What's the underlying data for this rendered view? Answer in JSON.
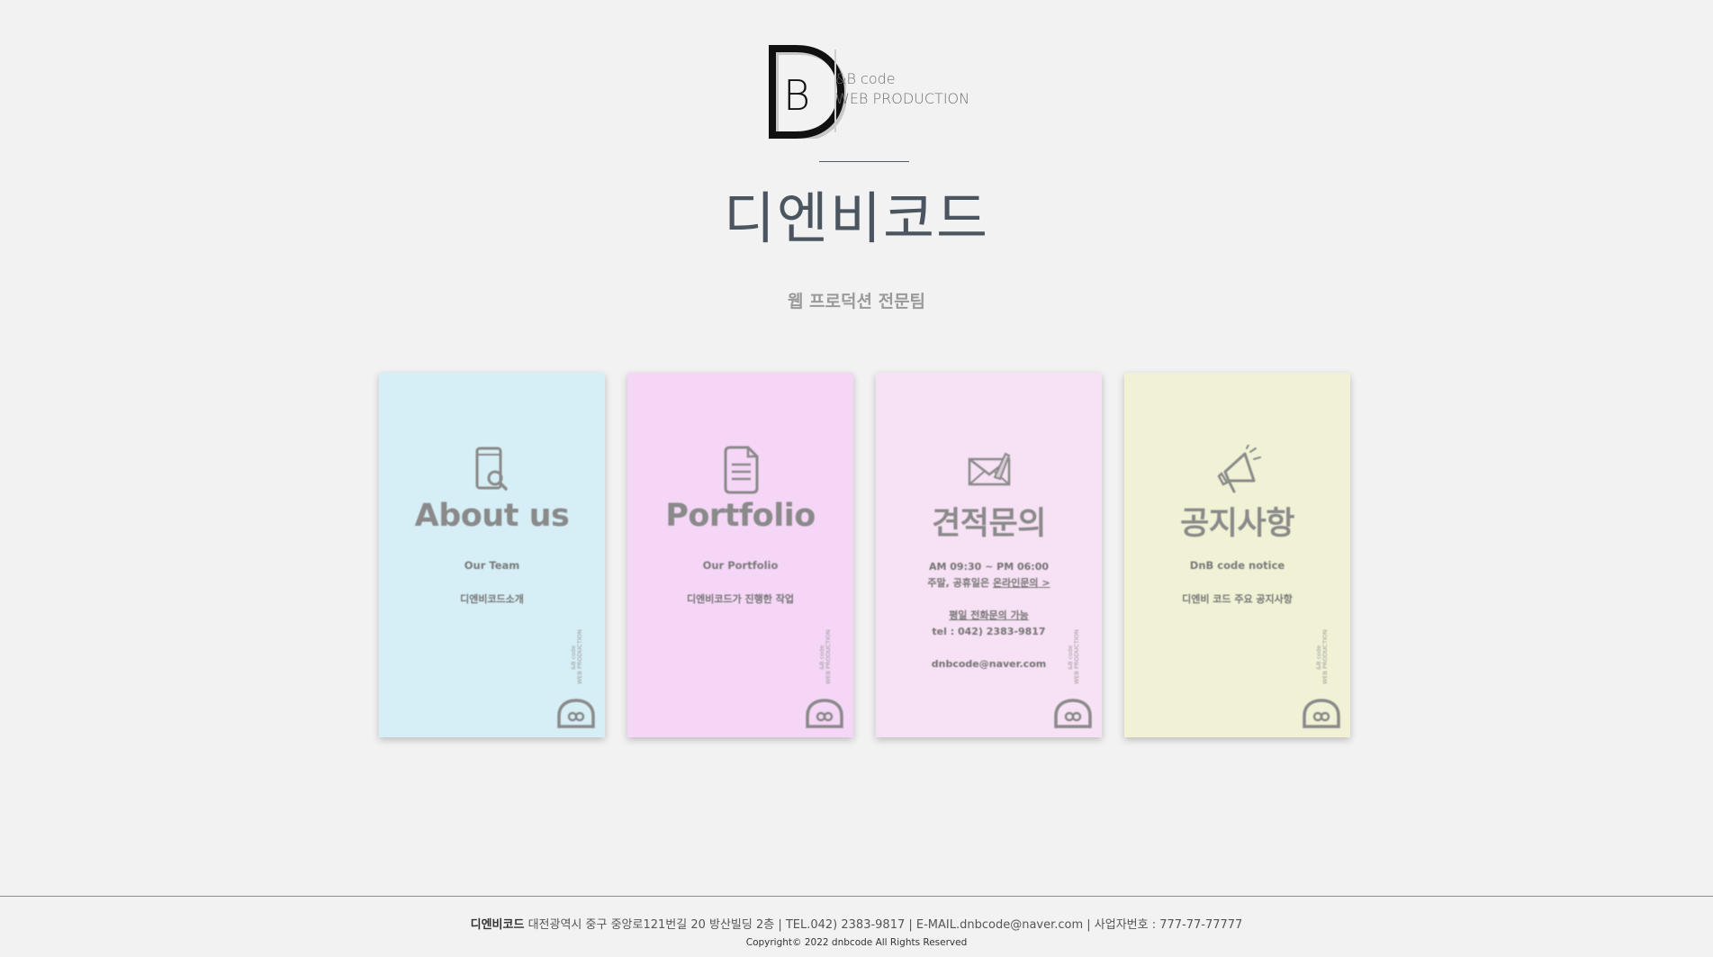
{
  "logo": {
    "letter_outer": "D",
    "letter_inner": "B",
    "line1": "&B code",
    "line2": "WEB PRODUCTION"
  },
  "header": {
    "title": "디엔비코드",
    "subtitle": "웹 프로덕션 전문팀"
  },
  "cards": [
    {
      "title": "About us",
      "sub": "Our Team",
      "desc": "디엔비코드소개",
      "bg": "#d6eff6",
      "icon": "phone-search-icon"
    },
    {
      "title": "Portfolio",
      "sub": "Our Portfolio",
      "desc": "디엔비코드가 진행한 작업",
      "bg": "#f5d6f6",
      "icon": "document-icon"
    },
    {
      "title": "견적문의",
      "hours": "AM 09:30 ~ PM 06:00",
      "holiday_prefix": "주말, 공휴일은 ",
      "holiday_link": "온라인문의 >",
      "weekday_phone": "평일 전화문의 가능",
      "tel": "tel : 042) 2383-9817",
      "email": "dnbcode@naver.com",
      "bg": "#f7e1f4",
      "icon": "mail-icon"
    },
    {
      "title": "공지사항",
      "sub": "DnB code notice",
      "desc": "디엔비 코드 주요 공지사항",
      "bg": "#f1f2d5",
      "icon": "megaphone-icon"
    }
  ],
  "badge": {
    "line1": "&B code",
    "line2": "WEB PRODUCTION"
  },
  "footer": {
    "company": "디엔비코드",
    "info": " 대전광역시 중구 중앙로121번길 20 방산빌딩 2층 | TEL.042) 2383-9817 | E-MAIL.dnbcode@naver.com | 사업자번호 : 777-77-77777",
    "copyright": "Copyright© 2022 dnbcode All Rights Reserved"
  }
}
